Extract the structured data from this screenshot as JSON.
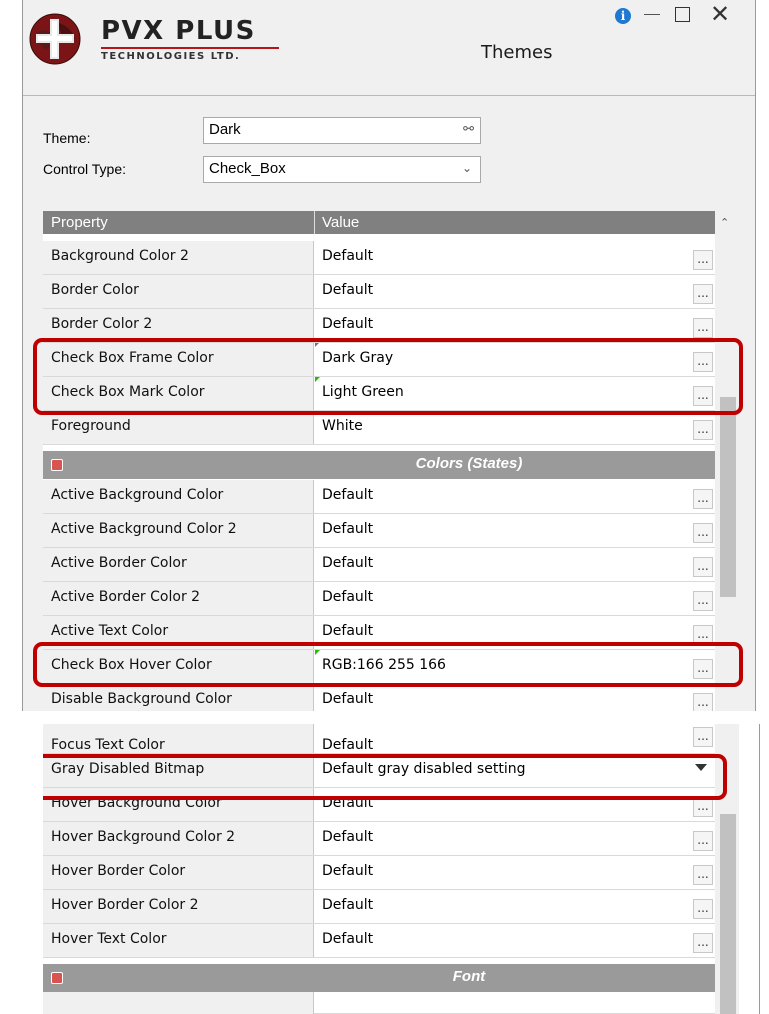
{
  "window": {
    "title": "Themes",
    "brand_name": "PVX PLUS",
    "brand_sub": "TECHNOLOGIES LTD."
  },
  "form": {
    "theme_label": "Theme:",
    "theme_value": "Dark",
    "control_type_label": "Control Type:",
    "control_type_value": "Check_Box"
  },
  "grid": {
    "col_property": "Property",
    "col_value": "Value",
    "rows_top": [
      {
        "property": "Background Color 2",
        "value": "Default"
      },
      {
        "property": "Border Color",
        "value": "Default"
      },
      {
        "property": "Border Color 2",
        "value": "Default"
      },
      {
        "property": "Check Box Frame Color",
        "value": "Dark Gray"
      },
      {
        "property": "Check Box Mark Color",
        "value": "Light Green"
      },
      {
        "property": "Foreground",
        "value": "White"
      }
    ],
    "section_states": "Colors (States)",
    "rows_states": [
      {
        "property": "Active Background Color",
        "value": "Default"
      },
      {
        "property": "Active Background Color 2",
        "value": "Default"
      },
      {
        "property": "Active Border Color",
        "value": "Default"
      },
      {
        "property": "Active Border Color 2",
        "value": "Default"
      },
      {
        "property": "Active Text Color",
        "value": "Default"
      },
      {
        "property": "Check Box Hover Color",
        "value": "RGB:166 255 166"
      },
      {
        "property": "Disable Background Color",
        "value": "Default"
      }
    ],
    "rows_lower": [
      {
        "property": "Focus Text Color",
        "value": "Default"
      },
      {
        "property": "Gray Disabled Bitmap",
        "value": "Default gray disabled setting"
      },
      {
        "property": "Hover Background Color",
        "value": "Default"
      },
      {
        "property": "Hover Background Color 2",
        "value": "Default"
      },
      {
        "property": "Hover Border Color",
        "value": "Default"
      },
      {
        "property": "Hover Border Color 2",
        "value": "Default"
      },
      {
        "property": "Hover Text Color",
        "value": "Default"
      }
    ],
    "section_font": "Font",
    "ellipsis": "..."
  },
  "colors": {
    "highlight": "#c00000",
    "header_bg": "#808080",
    "section_bg": "#9a9a9a",
    "brand_accent": "#b8151b"
  },
  "icons": [
    "app-logo-icon",
    "info-icon",
    "minimize-icon",
    "maximize-icon",
    "close-icon",
    "binoculars-icon",
    "chevron-down-icon",
    "collapse-icon",
    "scroll-up-icon",
    "dropdown-arrow-icon"
  ]
}
